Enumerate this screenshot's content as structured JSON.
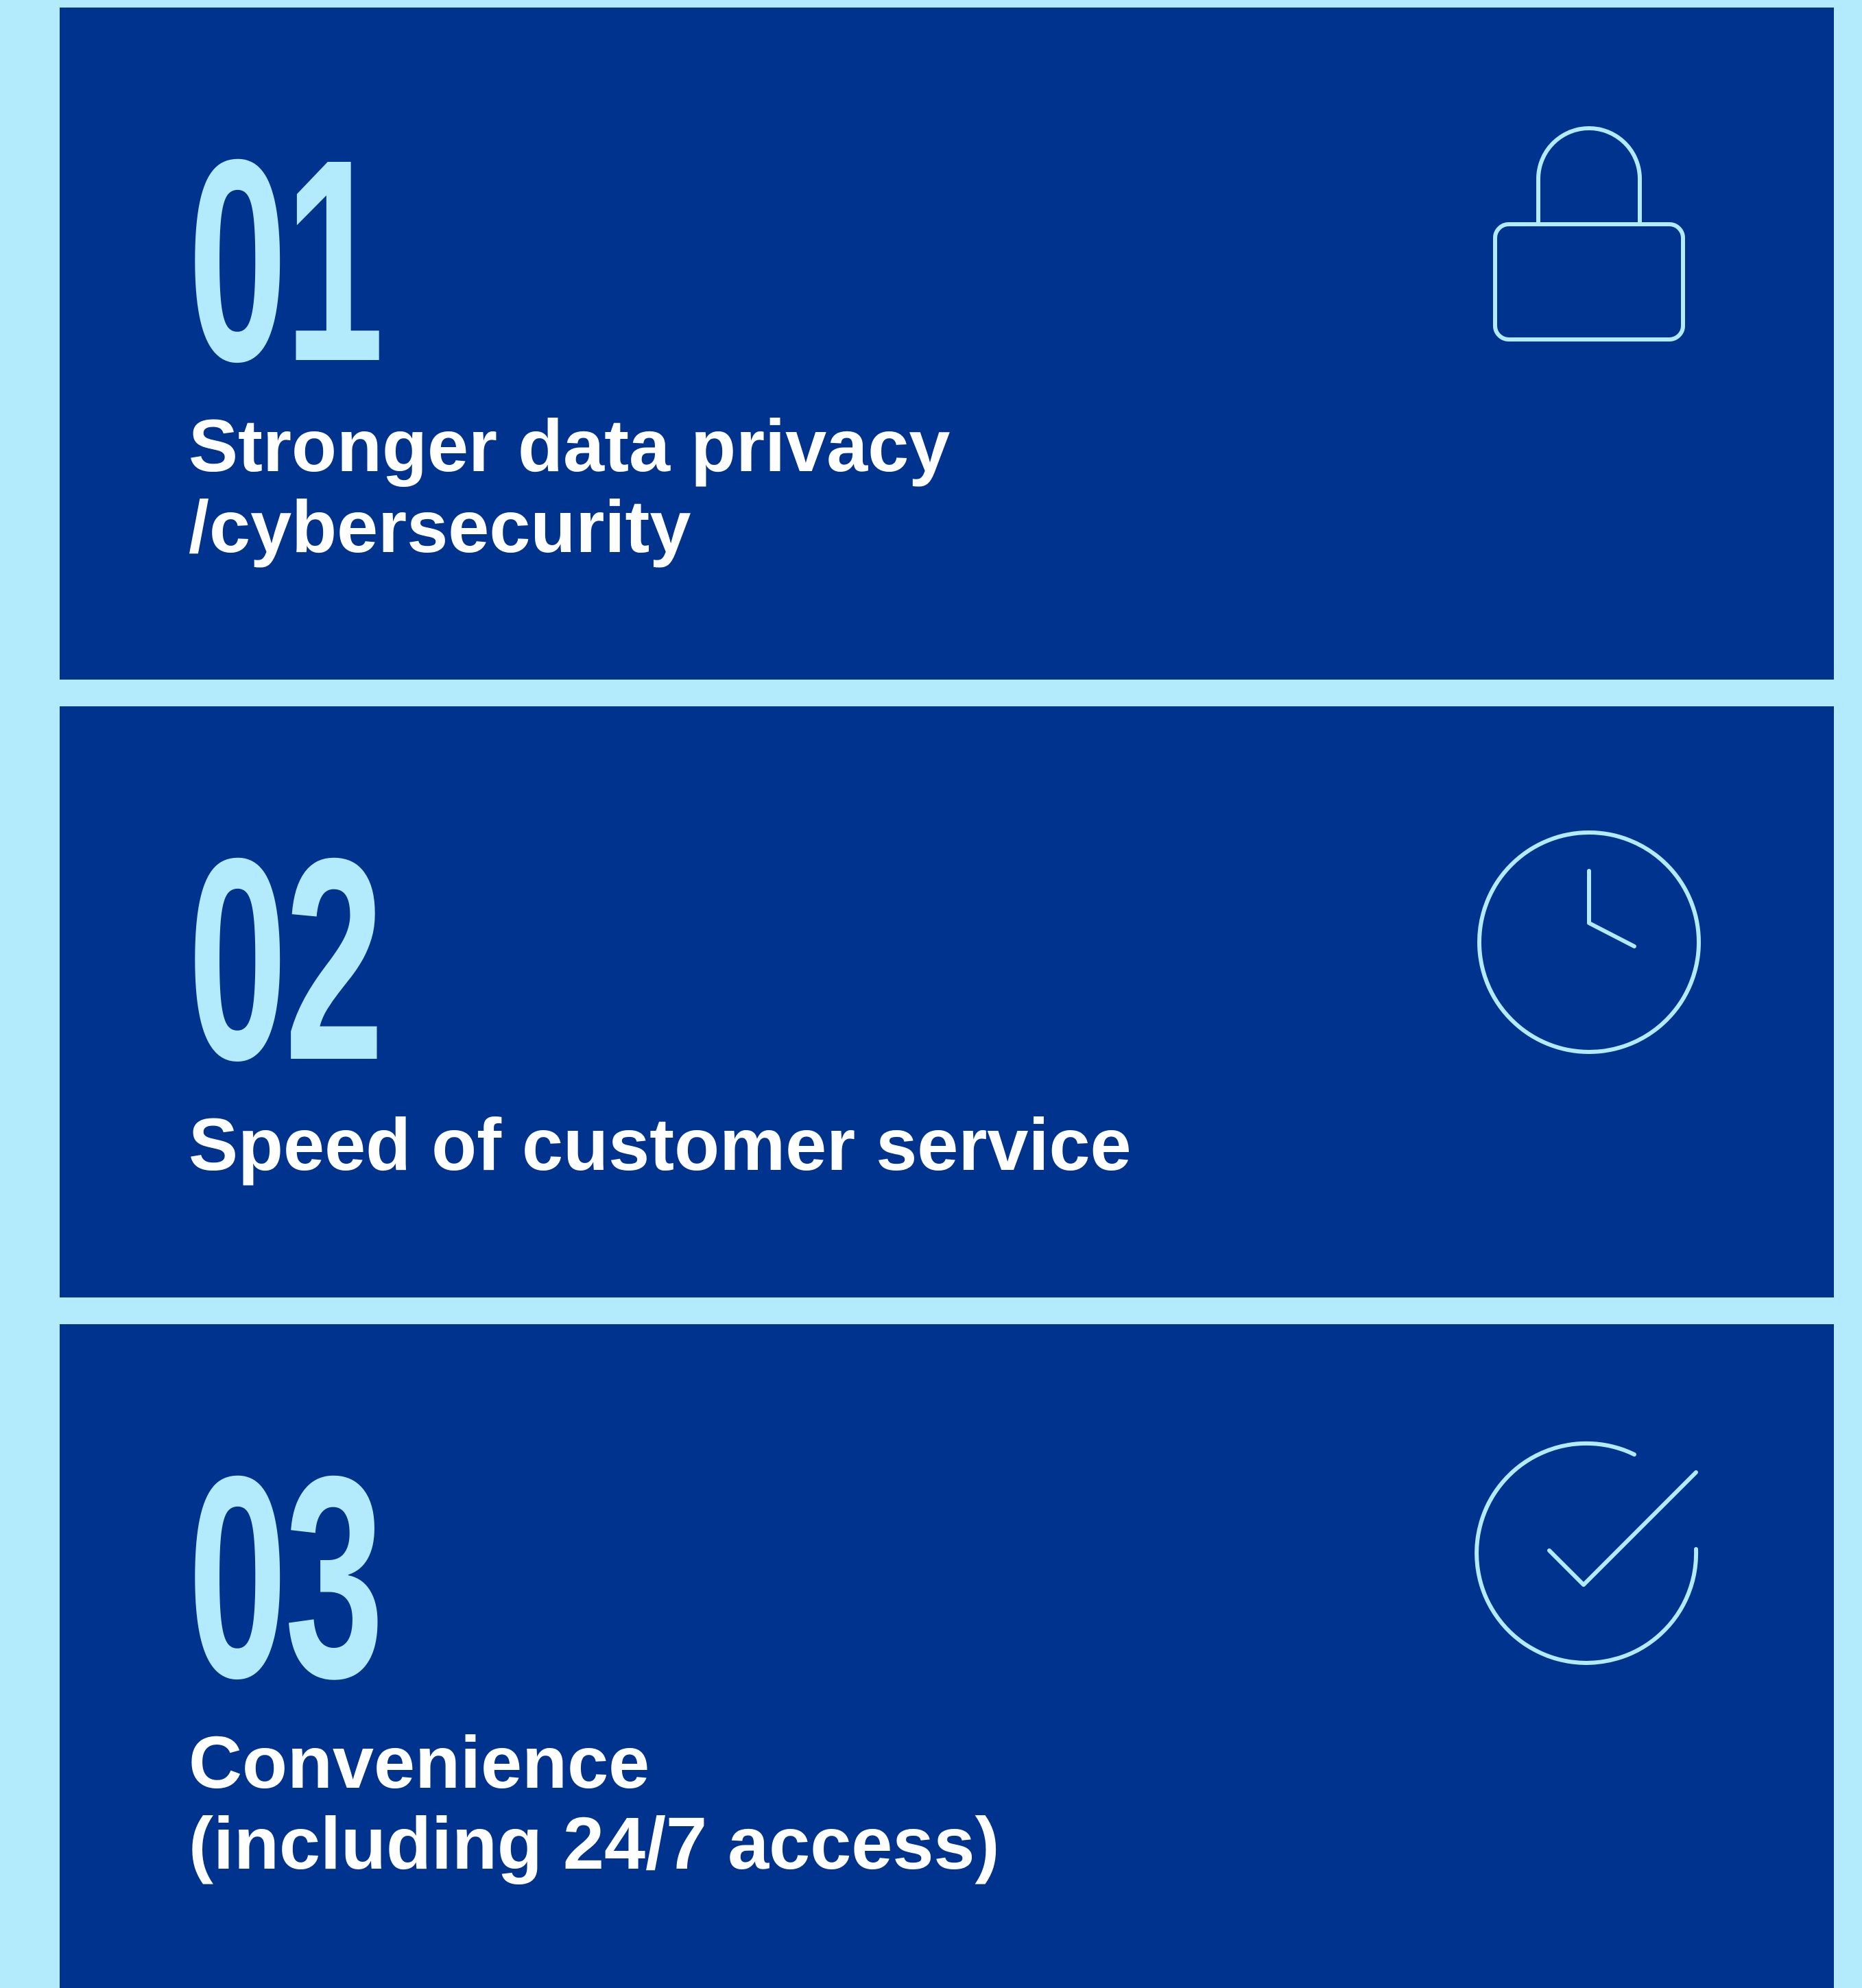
{
  "colors": {
    "background": "#b3ebfd",
    "card": "#00338d",
    "number": "#b3ebfd",
    "text": "#ffffff",
    "icon_stroke": "#b3ebfd"
  },
  "items": [
    {
      "number": "01",
      "lines": [
        "Stronger data privacy",
        "/cybersecurity"
      ],
      "icon": "lock-icon"
    },
    {
      "number": "02",
      "lines": [
        "Speed of customer service"
      ],
      "icon": "clock-icon"
    },
    {
      "number": "03",
      "lines": [
        "Convenience",
        "(including 24/7 access)"
      ],
      "icon": "check-circle-icon"
    }
  ]
}
